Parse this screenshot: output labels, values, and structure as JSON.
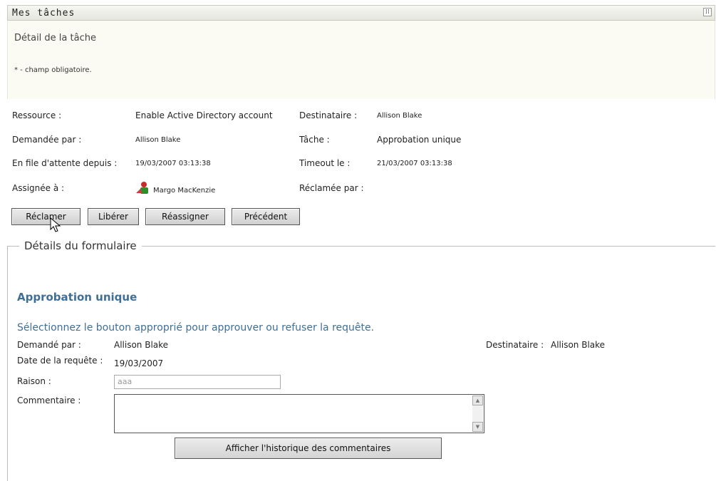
{
  "header": {
    "title": "Mes tâches",
    "menu_icon": "grid-icon"
  },
  "detail": {
    "title": "Détail de la tâche",
    "required_note": "* - champ obligatoire."
  },
  "task": {
    "resource_label": "Ressource :",
    "resource_value": "Enable Active Directory account",
    "recipient_label": "Destinataire :",
    "recipient_value": "Allison Blake",
    "requested_by_label": "Demandée par :",
    "requested_by_value": "Allison Blake",
    "task_label": "Tâche :",
    "task_value": "Approbation unique",
    "queued_since_label": "En file d'attente depuis :",
    "queued_since_value": "19/03/2007 03:13:38",
    "timeout_label": "Timeout le :",
    "timeout_value": "21/03/2007 03:13:38",
    "assigned_to_label": "Assignée à :",
    "assigned_to_value": "Margo MacKenzie",
    "claimed_by_label": "Réclamée par :",
    "claimed_by_value": ""
  },
  "buttons": {
    "claim": "Réclamer",
    "release": "Libérer",
    "reassign": "Réassigner",
    "previous": "Précédent"
  },
  "form": {
    "legend": "Détails du formulaire",
    "title": "Approbation unique",
    "instruction": "Sélectionnez le bouton approprié pour approuver ou refuser la requête.",
    "requested_by_label": "Demandé par :",
    "requested_by_value": "Allison Blake",
    "recipient_label": "Destinataire :",
    "recipient_value": "Allison Blake",
    "request_date_label": "Date de la requête :",
    "request_date_value": "19/03/2007",
    "reason_label": "Raison :",
    "reason_value": "aaa",
    "comment_label": "Commentaire :",
    "comment_value": "",
    "history_button": "Afficher l'historique des commentaires"
  },
  "colors": {
    "accent": "#3f6f97",
    "header_bg": "#eeeeea",
    "detail_bg": "#fbfbf3"
  }
}
